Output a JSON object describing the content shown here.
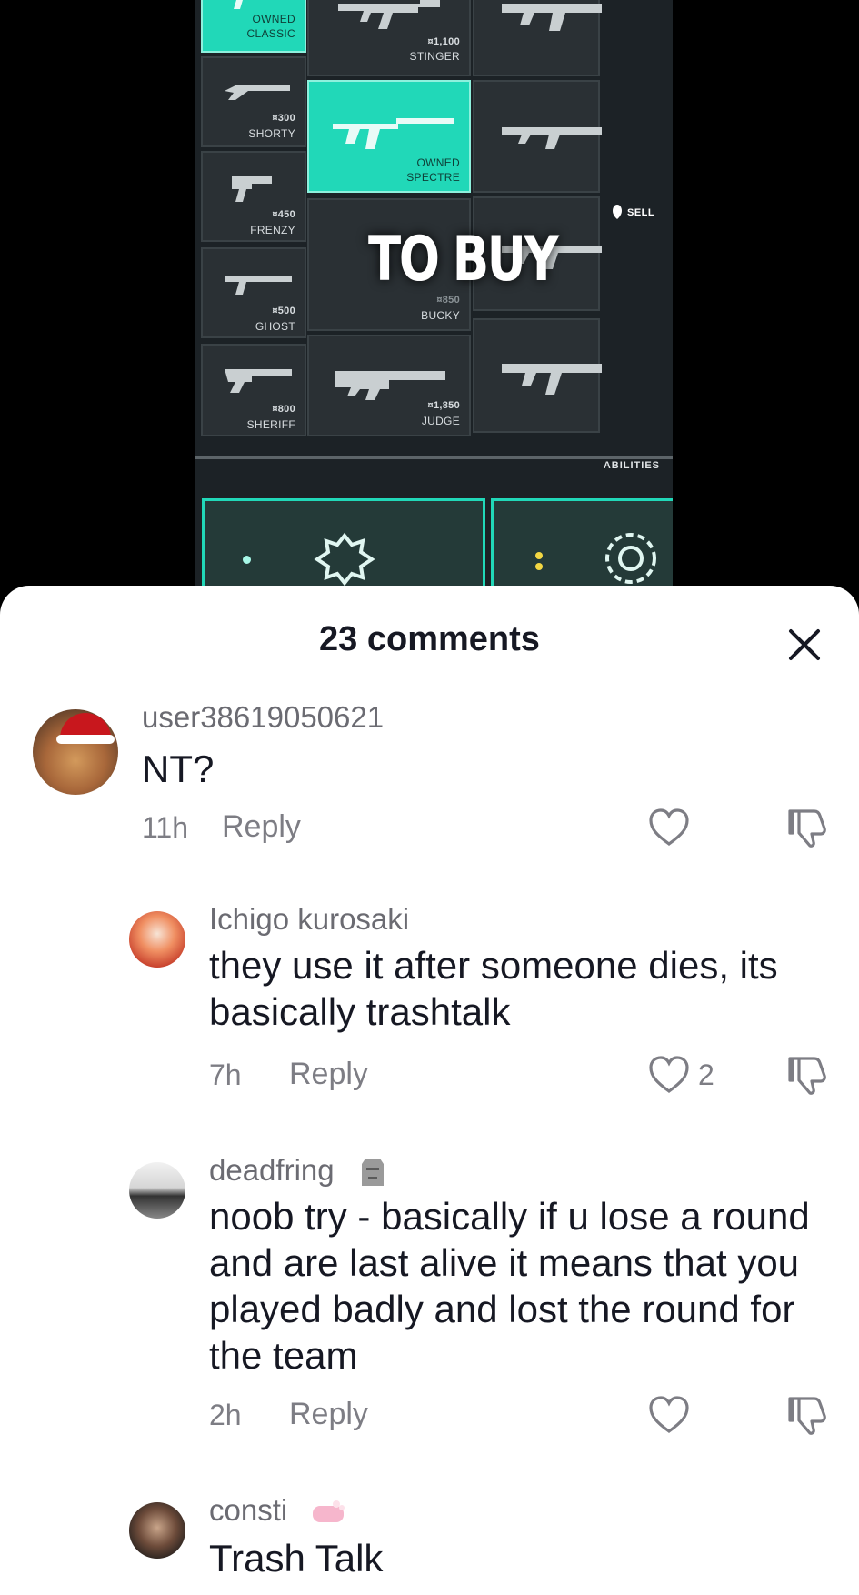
{
  "video": {
    "weapons": [
      {
        "name": "CLASSIC",
        "status": "OWNED",
        "price": ""
      },
      {
        "name": "STINGER",
        "price": "¤1,100"
      },
      {
        "name": "SHORTY",
        "price": "¤300"
      },
      {
        "name": "SPECTRE",
        "status": "OWNED",
        "price": ""
      },
      {
        "name": "FRENZY",
        "price": "¤450"
      },
      {
        "name": "GHOST",
        "price": "¤500"
      },
      {
        "name": "BUCKY",
        "price": "¤850"
      },
      {
        "name": "SHERIFF",
        "price": "¤800"
      },
      {
        "name": "JUDGE",
        "price": "¤1,850"
      }
    ],
    "sell_label": "SELL",
    "overlay_caption": "TO BUY",
    "abilities_label": "ABILITIES",
    "accent_color": "#21d8b8"
  },
  "sheet": {
    "title": "23 comments",
    "close_icon": "close-icon"
  },
  "comments": [
    {
      "username": "user38619050621",
      "text": "NT?",
      "time": "11h",
      "reply_label": "Reply",
      "likes": ""
    },
    {
      "username": "Ichigo kurosaki",
      "text": "they use it after someone dies, its basically trashtalk",
      "time": "7h",
      "reply_label": "Reply",
      "likes": "2"
    },
    {
      "username": "deadfring",
      "username_emoji": "moai-emoji",
      "text": "noob try - basically if u lose a round and are last alive it means that you played badly and lost the round for the team",
      "time": "2h",
      "reply_label": "Reply",
      "likes": ""
    },
    {
      "username": "consti",
      "username_emoji": "soap-emoji",
      "text": "Trash Talk",
      "time": "",
      "reply_label": "",
      "likes": ""
    }
  ]
}
